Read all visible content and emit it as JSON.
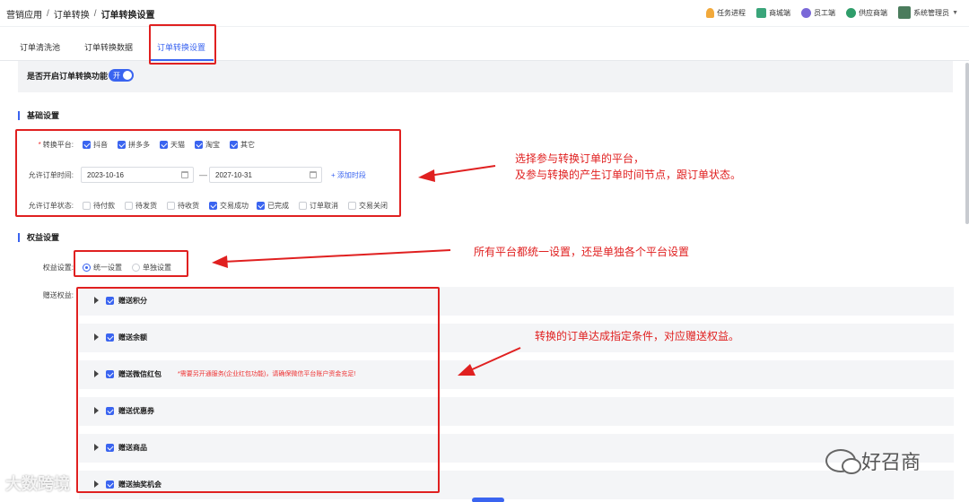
{
  "breadcrumb": [
    "营销应用",
    "订单转换",
    "订单转换设置"
  ],
  "topnav": {
    "items": [
      {
        "label": "任务进程",
        "icon": "bell-icon"
      },
      {
        "label": "商城端",
        "icon": "shop-icon"
      },
      {
        "label": "员工端",
        "icon": "staff-icon"
      },
      {
        "label": "供应商端",
        "icon": "supplier-icon"
      }
    ],
    "user": "系统管理员"
  },
  "tabs": [
    "订单清洗池",
    "订单转换数据",
    "订单转换设置"
  ],
  "toggle": {
    "label": "是否开启订单转换功能",
    "state": "开"
  },
  "basic": {
    "title": "基础设置",
    "platform_label": "转换平台:",
    "platforms": [
      {
        "label": "抖音",
        "checked": true
      },
      {
        "label": "拼多多",
        "checked": true
      },
      {
        "label": "天猫",
        "checked": true
      },
      {
        "label": "淘宝",
        "checked": true
      },
      {
        "label": "其它",
        "checked": true
      }
    ],
    "time_label": "允许订单时间:",
    "start_date": "2023-10-16",
    "end_date": "2027-10-31",
    "dash": "—",
    "add_time": "+ 添加时段",
    "status_label": "允许订单状态:",
    "statuses": [
      {
        "label": "待付款",
        "checked": false
      },
      {
        "label": "待发货",
        "checked": false
      },
      {
        "label": "待收货",
        "checked": false
      },
      {
        "label": "交易成功",
        "checked": true
      },
      {
        "label": "已完成",
        "checked": true
      },
      {
        "label": "订单取消",
        "checked": false
      },
      {
        "label": "交易关闭",
        "checked": false
      }
    ]
  },
  "rights": {
    "title": "权益设置",
    "setting_label": "权益设置:",
    "options": [
      {
        "label": "统一设置",
        "selected": true
      },
      {
        "label": "单独设置",
        "selected": false
      }
    ],
    "gift_label": "赠送权益:",
    "benefits": [
      {
        "label": "赠送积分",
        "checked": true,
        "note": ""
      },
      {
        "label": "赠送余额",
        "checked": true,
        "note": ""
      },
      {
        "label": "赠送微信红包",
        "checked": true,
        "note": "*需要另开通服务(企业红包功能)，请确保微信平台账户资金充足!"
      },
      {
        "label": "赠送优惠券",
        "checked": true,
        "note": ""
      },
      {
        "label": "赠送商品",
        "checked": true,
        "note": ""
      },
      {
        "label": "赠送抽奖机会",
        "checked": true,
        "note": ""
      }
    ]
  },
  "annotations": {
    "a1_line1": "选择参与转换订单的平台，",
    "a1_line2": "及参与转换的产生订单时间节点，跟订单状态。",
    "a2": "所有平台都统一设置，还是单独各个平台设置",
    "a3": "转换的订单达成指定条件，对应赠送权益。"
  },
  "watermarks": {
    "left": "大数跨境",
    "right": "好召商"
  },
  "colors": {
    "accent": "#3a64f0",
    "annotation": "#e02020"
  }
}
